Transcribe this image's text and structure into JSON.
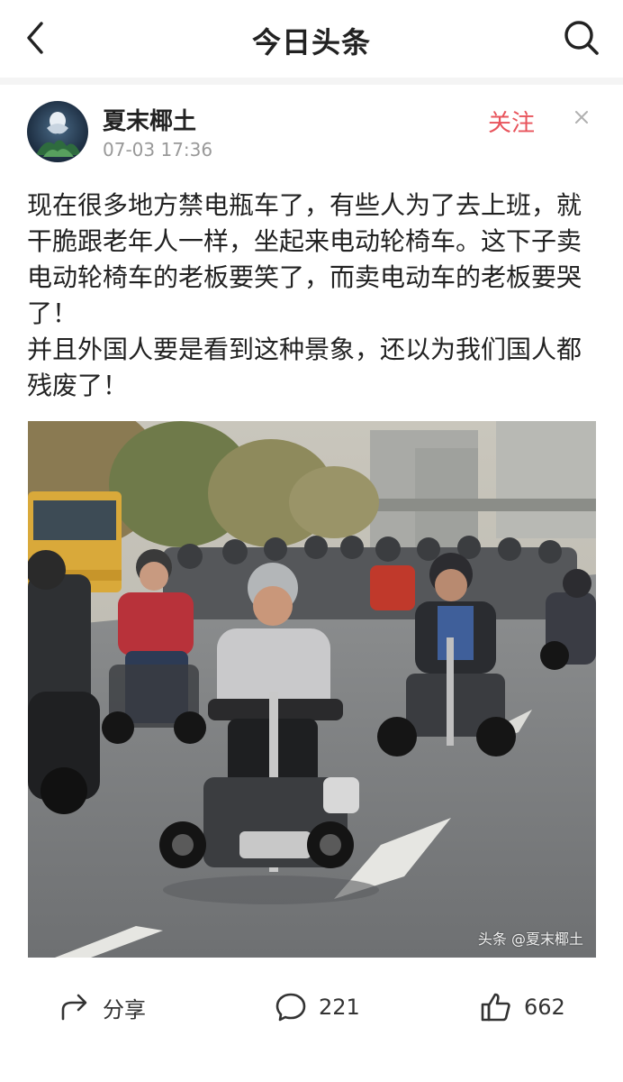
{
  "nav": {
    "title": "今日头条",
    "back_icon": "chevron-left-icon",
    "search_icon": "search-icon"
  },
  "author": {
    "name": "夏末椰土",
    "time": "07-03 17:36",
    "follow_label": "关注"
  },
  "post": {
    "paragraphs": [
      "现在很多地方禁电瓶车了，有些人为了去上班，就干脆跟老年人一样，坐起来电动轮椅车。这下子卖电动轮椅车的老板要笑了，而卖电动车的老板要哭了！",
      "并且外国人要是看到这种景象，还以为我们国人都残废了！"
    ],
    "image_watermark": "头条 @夏末椰土"
  },
  "actions": {
    "share_label": "分享",
    "comment_count": "221",
    "like_count": "662"
  },
  "colors": {
    "accent": "#e8545c",
    "text": "#222222",
    "muted": "#999999"
  }
}
